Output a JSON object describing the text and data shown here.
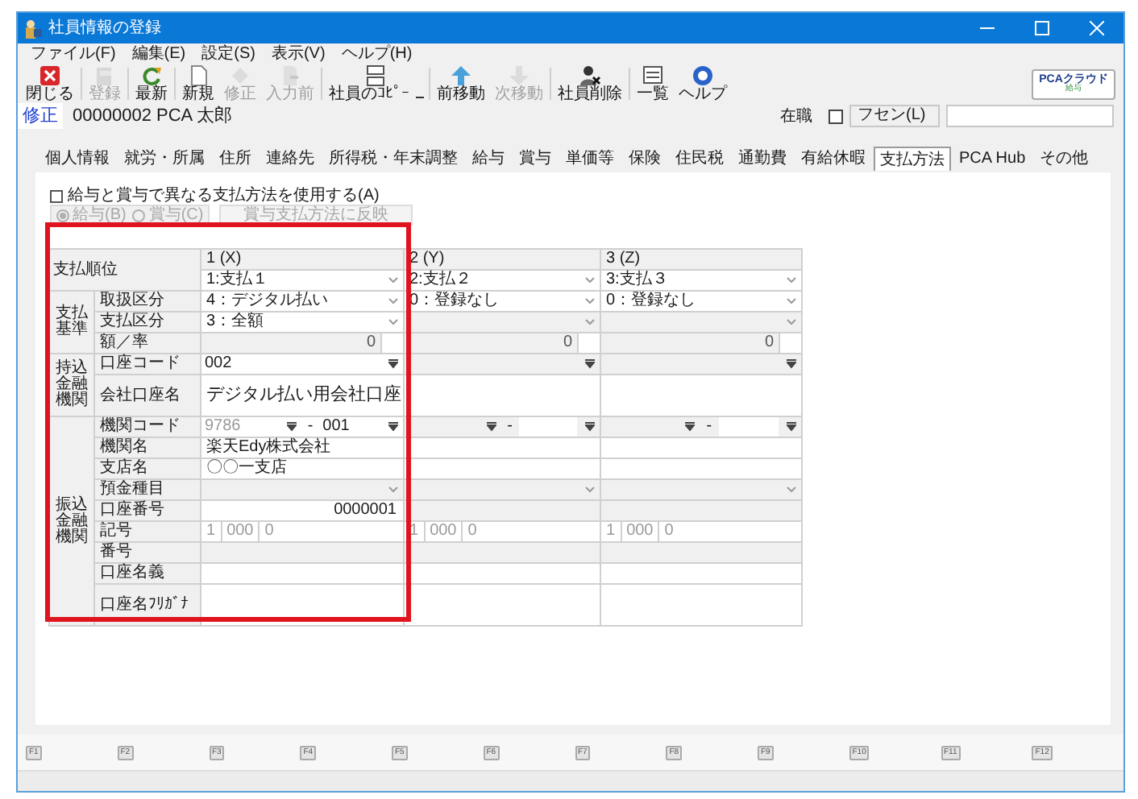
{
  "window": {
    "title": "社員情報の登録"
  },
  "menu": [
    "ファイル(F)",
    "編集(E)",
    "設定(S)",
    "表示(V)",
    "ヘルプ(H)"
  ],
  "toolbar": [
    {
      "label": "閉じる",
      "disabled": false,
      "dropdown": false,
      "separator_after": true
    },
    {
      "label": "登録",
      "disabled": true,
      "dropdown": false,
      "separator_after": true
    },
    {
      "label": "最新",
      "disabled": false,
      "dropdown": false,
      "separator_after": true
    },
    {
      "label": "新規",
      "disabled": false,
      "dropdown": false,
      "separator_after": false
    },
    {
      "label": "修正",
      "disabled": true,
      "dropdown": false,
      "separator_after": false
    },
    {
      "label": "入力前",
      "disabled": true,
      "dropdown": false,
      "separator_after": true
    },
    {
      "label": "社員のｺﾋﾟｰ",
      "disabled": false,
      "dropdown": true,
      "separator_after": true
    },
    {
      "label": "前移動",
      "disabled": false,
      "dropdown": false,
      "separator_after": false
    },
    {
      "label": "次移動",
      "disabled": true,
      "dropdown": false,
      "separator_after": true
    },
    {
      "label": "社員削除",
      "disabled": false,
      "dropdown": false,
      "separator_after": true
    },
    {
      "label": "一覧",
      "disabled": false,
      "dropdown": false,
      "separator_after": false
    },
    {
      "label": "ヘルプ",
      "disabled": false,
      "dropdown": false,
      "separator_after": false
    }
  ],
  "brand": {
    "name": "PCAクラウド",
    "product": "給与"
  },
  "record": {
    "mode": "修正",
    "employee": "00000002 PCA 太郎",
    "status": "在職",
    "sticky_checked": false,
    "sticky_label": "フセン(L)"
  },
  "tabs": [
    {
      "label": "個人情報",
      "selected": false
    },
    {
      "label": "就労・所属",
      "selected": false
    },
    {
      "label": "住所",
      "selected": false
    },
    {
      "label": "連絡先",
      "selected": false
    },
    {
      "label": "所得税・年末調整",
      "selected": false
    },
    {
      "label": "給与",
      "selected": false
    },
    {
      "label": "賞与",
      "selected": false
    },
    {
      "label": "単価等",
      "selected": false
    },
    {
      "label": "保険",
      "selected": false
    },
    {
      "label": "住民税",
      "selected": false
    },
    {
      "label": "通勤費",
      "selected": false
    },
    {
      "label": "有給休暇",
      "selected": false
    },
    {
      "label": "支払方法",
      "selected": true
    },
    {
      "label": "PCA Hub",
      "selected": false
    },
    {
      "label": "その他",
      "selected": false
    }
  ],
  "options": {
    "label": "給与と賞与で異なる支払方法を使用する(A)",
    "checked": false,
    "radios": [
      {
        "label": "給与(B)",
        "selected": true,
        "disabled": true
      },
      {
        "label": "賞与(C)",
        "selected": false,
        "disabled": true
      }
    ],
    "reflect_button": {
      "label": "賞与支払方法に反映",
      "disabled": true
    }
  },
  "grid": {
    "order_label": "支払順位",
    "columns": [
      {
        "heading": "1 (X)",
        "order": "1:支払１"
      },
      {
        "heading": "2 (Y)",
        "order": "2:支払２"
      },
      {
        "heading": "3 (Z)",
        "order": "3:支払３"
      }
    ],
    "groups": [
      {
        "label": "支払基準",
        "rows": [
          {
            "label": "取扱区分",
            "kind": "select",
            "cells": [
              {
                "value": "4：デジタル払い",
                "disabled": false
              },
              {
                "value": "0：登録なし",
                "disabled": false
              },
              {
                "value": "0：登録なし",
                "disabled": false
              }
            ]
          },
          {
            "label": "支払区分",
            "kind": "select",
            "cells": [
              {
                "value": "3：全額",
                "disabled": false
              },
              {
                "disabled": true
              },
              {
                "disabled": true
              }
            ]
          },
          {
            "label": "額／率",
            "kind": "number",
            "cells": [
              {
                "value": "0",
                "disabled": true
              },
              {
                "value": "0",
                "disabled": true
              },
              {
                "value": "0",
                "disabled": true
              }
            ]
          }
        ]
      },
      {
        "label": "持込金融機関",
        "rows": [
          {
            "label": "口座コード",
            "kind": "code",
            "cells": [
              {
                "value": "002",
                "disabled": false
              },
              {
                "disabled": true
              },
              {
                "disabled": true
              }
            ]
          },
          {
            "label": "会社口座名",
            "kind": "text",
            "tall": true,
            "cells": [
              {
                "value": "デジタル払い用会社口座",
                "disabled": false
              },
              {
                "disabled": false
              },
              {
                "disabled": false
              }
            ]
          }
        ]
      },
      {
        "label": "振込金融機関",
        "rows": [
          {
            "label": "機関コード",
            "kind": "bank_code",
            "cells": [
              {
                "code": "9786",
                "dash": "-",
                "branch": "001",
                "disabled": false
              },
              {
                "dash": "-",
                "disabled": true
              },
              {
                "dash": "-",
                "disabled": true
              }
            ]
          },
          {
            "label": "機関名",
            "kind": "text",
            "cells": [
              {
                "value": "楽天Edy株式会社",
                "disabled": false
              },
              {
                "disabled": false
              },
              {
                "disabled": false
              }
            ]
          },
          {
            "label": "支店名",
            "kind": "text",
            "cells": [
              {
                "value": "〇〇一支店",
                "disabled": false
              },
              {
                "disabled": false
              },
              {
                "disabled": false
              }
            ]
          },
          {
            "label": "預金種目",
            "kind": "select",
            "cells": [
              {
                "disabled": true
              },
              {
                "disabled": true
              },
              {
                "disabled": true
              }
            ]
          },
          {
            "label": "口座番号",
            "kind": "account",
            "cells": [
              {
                "value": "0000001",
                "disabled": false
              },
              {
                "disabled": true
              },
              {
                "disabled": true
              }
            ]
          },
          {
            "label": "記号",
            "kind": "symbol",
            "cells": [
              {
                "parts": [
                  "1",
                  "000",
                  "0"
                ],
                "disabled": false
              },
              {
                "parts": [
                  "1",
                  "000",
                  "0"
                ],
                "disabled": false
              },
              {
                "parts": [
                  "1",
                  "000",
                  "0"
                ],
                "disabled": false
              }
            ]
          },
          {
            "label": "番号",
            "kind": "text",
            "cells": [
              {
                "disabled": true
              },
              {
                "disabled": true
              },
              {
                "disabled": true
              }
            ]
          },
          {
            "label": "口座名義",
            "kind": "text",
            "cells": [
              {
                "disabled": false
              },
              {
                "disabled": false
              },
              {
                "disabled": false
              }
            ]
          },
          {
            "label": "口座名ﾌﾘｶﾞﾅ",
            "kind": "text",
            "tall": true,
            "cells": [
              {
                "disabled": false
              },
              {
                "disabled": false
              },
              {
                "disabled": false
              }
            ]
          }
        ]
      }
    ]
  },
  "function_keys": [
    "F1",
    "F2",
    "F3",
    "F4",
    "F5",
    "F6",
    "F7",
    "F8",
    "F9",
    "F10",
    "F11",
    "F12"
  ],
  "highlight_frame": true
}
